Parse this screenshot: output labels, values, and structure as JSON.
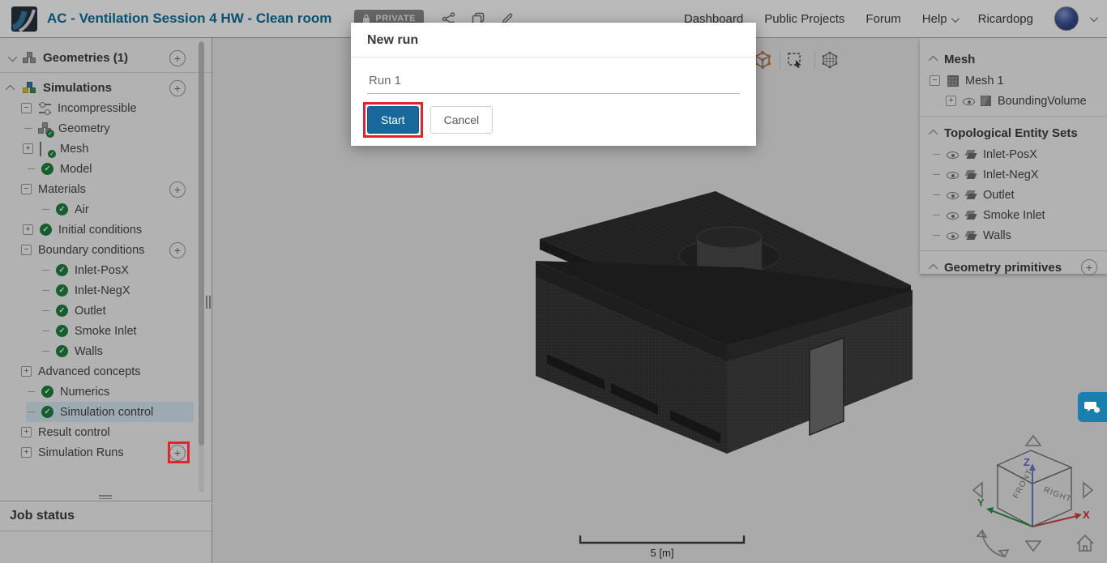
{
  "header": {
    "title": "AC - Ventilation Session 4 HW - Clean room",
    "privacy": "PRIVATE",
    "nav": {
      "dashboard": "Dashboard",
      "public_projects": "Public Projects",
      "forum": "Forum",
      "help": "Help",
      "username": "Ricardopg"
    }
  },
  "icons": {
    "privacy": "lock-icon",
    "share": "share-icon",
    "duplicate": "copy-icon",
    "edit": "pencil-icon",
    "tree_add": "plus-circle-icon",
    "status_ok": "check-circle-icon",
    "visibility": "eye-icon"
  },
  "left_tree": {
    "items": [
      {
        "label": "Geometries (1)"
      },
      {
        "label": "Simulations"
      },
      {
        "label": "Incompressible"
      },
      {
        "label": "Geometry"
      },
      {
        "label": "Mesh"
      },
      {
        "label": "Model"
      },
      {
        "label": "Materials"
      },
      {
        "label": "Air"
      },
      {
        "label": "Initial conditions"
      },
      {
        "label": "Boundary conditions"
      },
      {
        "label": "Inlet-PosX"
      },
      {
        "label": "Inlet-NegX"
      },
      {
        "label": "Outlet"
      },
      {
        "label": "Smoke Inlet"
      },
      {
        "label": "Walls"
      },
      {
        "label": "Advanced concepts"
      },
      {
        "label": "Numerics"
      },
      {
        "label": "Simulation control"
      },
      {
        "label": "Result control"
      },
      {
        "label": "Simulation Runs"
      }
    ]
  },
  "job_status": {
    "title": "Job status"
  },
  "modal": {
    "title": "New run",
    "run_name": "Run 1",
    "start": "Start",
    "cancel": "Cancel"
  },
  "right_panel": {
    "mesh_header": "Mesh",
    "mesh1": "Mesh 1",
    "bounding": "BoundingVolume",
    "topo_header": "Topological Entity Sets",
    "topo_items": [
      "Inlet-PosX",
      "Inlet-NegX",
      "Outlet",
      "Smoke Inlet",
      "Walls"
    ],
    "prims_header": "Geometry primitives"
  },
  "viewport": {
    "scale_label": "5 [m]",
    "cube": {
      "front": "FRONT",
      "right": "RIGHT",
      "x": "X",
      "y": "Y",
      "z": "Z"
    }
  },
  "colors": {
    "accent": "#0c6f9c",
    "selected_row": "#d9e9f4",
    "check_green": "#1e8240",
    "annotation_red": "#e8212e",
    "start_button": "#16699a",
    "chat_blue": "#1b7fae"
  }
}
